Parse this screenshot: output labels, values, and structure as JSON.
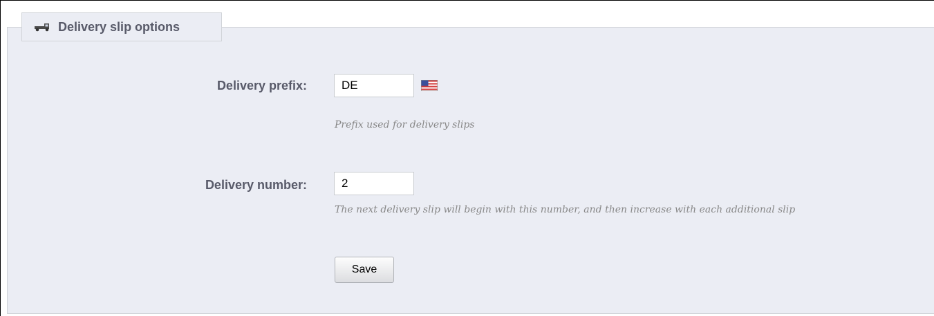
{
  "fieldset": {
    "legend": "Delivery slip options",
    "legend_icon": "truck-icon"
  },
  "fields": {
    "prefix": {
      "label": "Delivery prefix:",
      "value": "DE",
      "language_icon": "us-flag-icon",
      "help": "Prefix used for delivery slips"
    },
    "number": {
      "label": "Delivery number:",
      "value": "2",
      "help": "The next delivery slip will begin with this number, and then increase with each additional slip"
    }
  },
  "actions": {
    "save_label": "Save"
  }
}
